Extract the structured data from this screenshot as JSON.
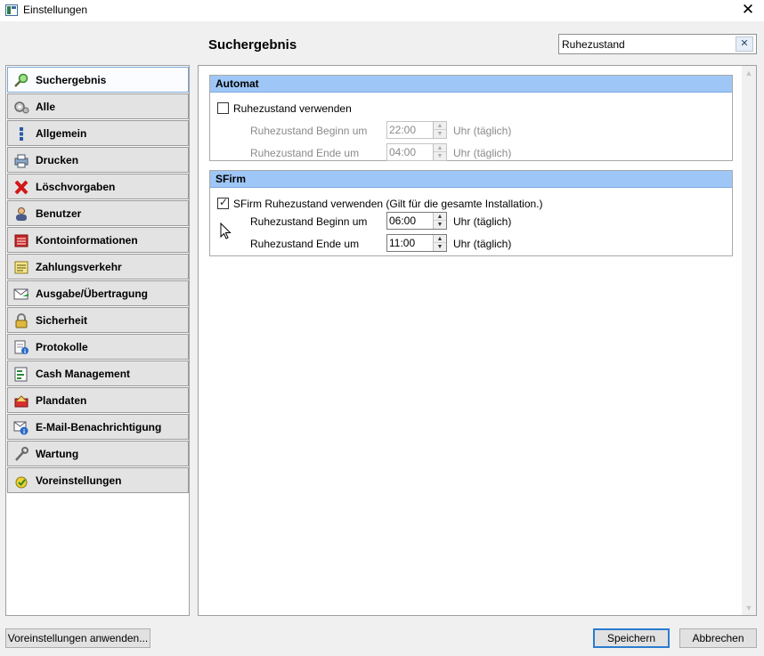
{
  "window": {
    "title": "Einstellungen",
    "close_icon": "close-icon"
  },
  "header": {
    "title": "Suchergebnis"
  },
  "search": {
    "value": "Ruhezustand",
    "clear_label": "✕"
  },
  "sidebar": {
    "items": [
      {
        "label": "Suchergebnis",
        "icon": "magnifier-icon",
        "selected": true
      },
      {
        "label": "Alle",
        "icon": "gears-icon"
      },
      {
        "label": "Allgemein",
        "icon": "dots-icon"
      },
      {
        "label": "Drucken",
        "icon": "printer-icon"
      },
      {
        "label": "Löschvorgaben",
        "icon": "red-x-icon"
      },
      {
        "label": "Benutzer",
        "icon": "user-icon"
      },
      {
        "label": "Kontoinformationen",
        "icon": "account-book-icon"
      },
      {
        "label": "Zahlungsverkehr",
        "icon": "payment-list-icon"
      },
      {
        "label": "Ausgabe/Übertragung",
        "icon": "envelope-transfer-icon"
      },
      {
        "label": "Sicherheit",
        "icon": "lock-icon"
      },
      {
        "label": "Protokolle",
        "icon": "log-info-icon"
      },
      {
        "label": "Cash Management",
        "icon": "cash-icon"
      },
      {
        "label": "Plandaten",
        "icon": "plan-icon"
      },
      {
        "label": "E-Mail-Benachrichtigung",
        "icon": "email-info-icon"
      },
      {
        "label": "Wartung",
        "icon": "wrench-icon"
      },
      {
        "label": "Voreinstellungen",
        "icon": "presets-icon"
      }
    ]
  },
  "groups": {
    "automat": {
      "title": "Automat",
      "checkbox_label": "Ruhezustand verwenden",
      "checked": false,
      "begin_label": "Ruhezustand Beginn um",
      "begin_value": "22:00",
      "end_label": "Ruhezustand Ende um",
      "end_value": "04:00",
      "unit": "Uhr (täglich)"
    },
    "sfirm": {
      "title": "SFirm",
      "checkbox_label": "SFirm Ruhezustand verwenden (Gilt für die gesamte Installation.)",
      "checked": true,
      "begin_label": "Ruhezustand Beginn um",
      "begin_value": "06:00",
      "end_label": "Ruhezustand Ende um",
      "end_value": "11:00",
      "unit": "Uhr (täglich)"
    }
  },
  "footer": {
    "defaults_button": "Voreinstellungen anwenden...",
    "save_button": "Speichern",
    "cancel_button": "Abbrechen"
  }
}
